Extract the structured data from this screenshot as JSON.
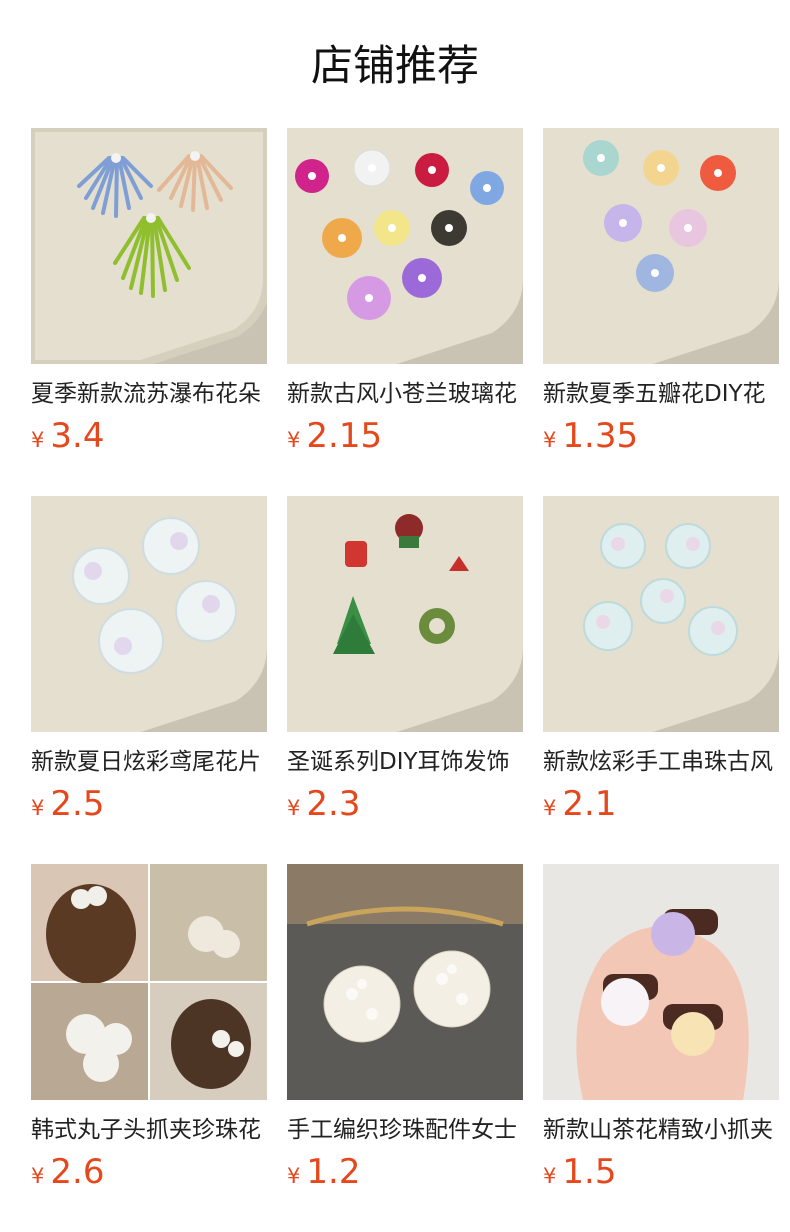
{
  "section_title": "店铺推荐",
  "currency": "¥",
  "products": [
    {
      "name": "夏季新款流苏瀑布花朵",
      "price": "3.4",
      "image": "tassel-flower-beads"
    },
    {
      "name": "新款古风小苍兰玻璃花",
      "price": "2.15",
      "image": "glass-freesia-flowers"
    },
    {
      "name": "新款夏季五瓣花DIY花",
      "price": "1.35",
      "image": "five-petal-flowers"
    },
    {
      "name": "新款夏日炫彩鸢尾花片",
      "price": "2.5",
      "image": "iridescent-iris-petals"
    },
    {
      "name": "圣诞系列DIY耳饰发饰",
      "price": "2.3",
      "image": "christmas-beaded-charms"
    },
    {
      "name": "新款炫彩手工串珠古风",
      "price": "2.1",
      "image": "beaded-iridescent-flowers"
    },
    {
      "name": "韩式丸子头抓夹珍珠花",
      "price": "2.6",
      "image": "flower-hair-claw-clips"
    },
    {
      "name": "手工编织珍珠配件女士",
      "price": "1.2",
      "image": "pearl-cluster-earrings"
    },
    {
      "name": "新款山茶花精致小抓夹",
      "price": "1.5",
      "image": "camellia-mini-claw-clips"
    }
  ]
}
